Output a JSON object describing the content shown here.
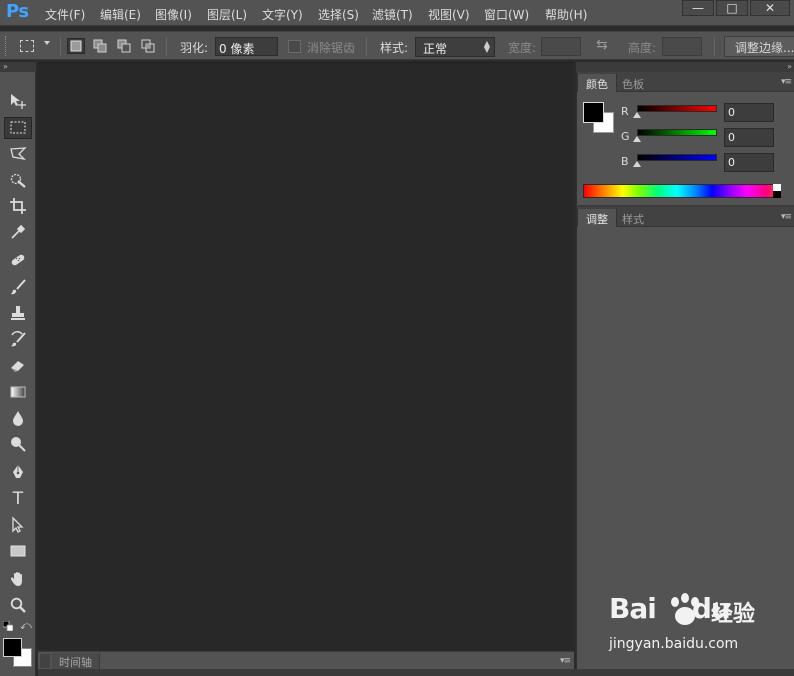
{
  "app": {
    "logo": "Ps"
  },
  "menu": [
    {
      "id": "file",
      "label": "文件(F)"
    },
    {
      "id": "edit",
      "label": "编辑(E)"
    },
    {
      "id": "image",
      "label": "图像(I)"
    },
    {
      "id": "layer",
      "label": "图层(L)"
    },
    {
      "id": "type",
      "label": "文字(Y)"
    },
    {
      "id": "select",
      "label": "选择(S)"
    },
    {
      "id": "filter",
      "label": "滤镜(T)"
    },
    {
      "id": "view",
      "label": "视图(V)"
    },
    {
      "id": "window",
      "label": "窗口(W)"
    },
    {
      "id": "help",
      "label": "帮助(H)"
    }
  ],
  "window_controls": {
    "minimize": "—",
    "maximize": "□",
    "close": "✕"
  },
  "options": {
    "feather_label": "羽化:",
    "feather_value": "0 像素",
    "antialias_label": "消除锯齿",
    "style_label": "样式:",
    "style_value": "正常",
    "width_label": "宽度:",
    "height_label": "高度:",
    "refine_edge_label": "调整边缘..."
  },
  "tools": [
    {
      "name": "move-tool-icon",
      "active": false
    },
    {
      "name": "rect-marquee-tool-icon",
      "active": true
    },
    {
      "name": "lasso-tool-icon",
      "active": false
    },
    {
      "name": "quick-select-tool-icon",
      "active": false
    },
    {
      "name": "crop-tool-icon",
      "active": false
    },
    {
      "name": "eyedropper-tool-icon",
      "active": false
    },
    {
      "name": "healing-brush-tool-icon",
      "active": false
    },
    {
      "name": "brush-tool-icon",
      "active": false
    },
    {
      "name": "clone-stamp-tool-icon",
      "active": false
    },
    {
      "name": "history-brush-tool-icon",
      "active": false
    },
    {
      "name": "eraser-tool-icon",
      "active": false
    },
    {
      "name": "gradient-tool-icon",
      "active": false
    },
    {
      "name": "blur-tool-icon",
      "active": false
    },
    {
      "name": "dodge-tool-icon",
      "active": false
    },
    {
      "name": "pen-tool-icon",
      "active": false
    },
    {
      "name": "type-tool-icon",
      "active": false
    },
    {
      "name": "path-select-tool-icon",
      "active": false
    },
    {
      "name": "rectangle-shape-tool-icon",
      "active": false
    },
    {
      "name": "hand-tool-icon",
      "active": false
    },
    {
      "name": "zoom-tool-icon",
      "active": false
    }
  ],
  "type_tool_glyph": "T",
  "swap_glyph": "⇆",
  "colors": {
    "foreground": "#000000",
    "background": "#ffffff",
    "accent": "#3fa3ff"
  },
  "timeline": {
    "tab_label": "时间轴"
  },
  "color_panel": {
    "tabs": [
      {
        "id": "color",
        "label": "颜色",
        "active": true
      },
      {
        "id": "swatches",
        "label": "色板",
        "active": false
      }
    ],
    "channels": [
      {
        "label": "R",
        "value": "0",
        "gradient": "#ff0000"
      },
      {
        "label": "G",
        "value": "0",
        "gradient": "#00ff00"
      },
      {
        "label": "B",
        "value": "0",
        "gradient": "#0000ff"
      }
    ]
  },
  "adjust_panel": {
    "tabs": [
      {
        "id": "adjustments",
        "label": "调整",
        "active": true
      },
      {
        "id": "styles",
        "label": "样式",
        "active": false
      }
    ]
  },
  "panel_menu_glyph": "▾≡",
  "collapse_glyph": "»",
  "watermark": {
    "brand": "Bai",
    "brand_suffix": "du",
    "jingyan": "经验",
    "url": "jingyan.baidu.com"
  }
}
